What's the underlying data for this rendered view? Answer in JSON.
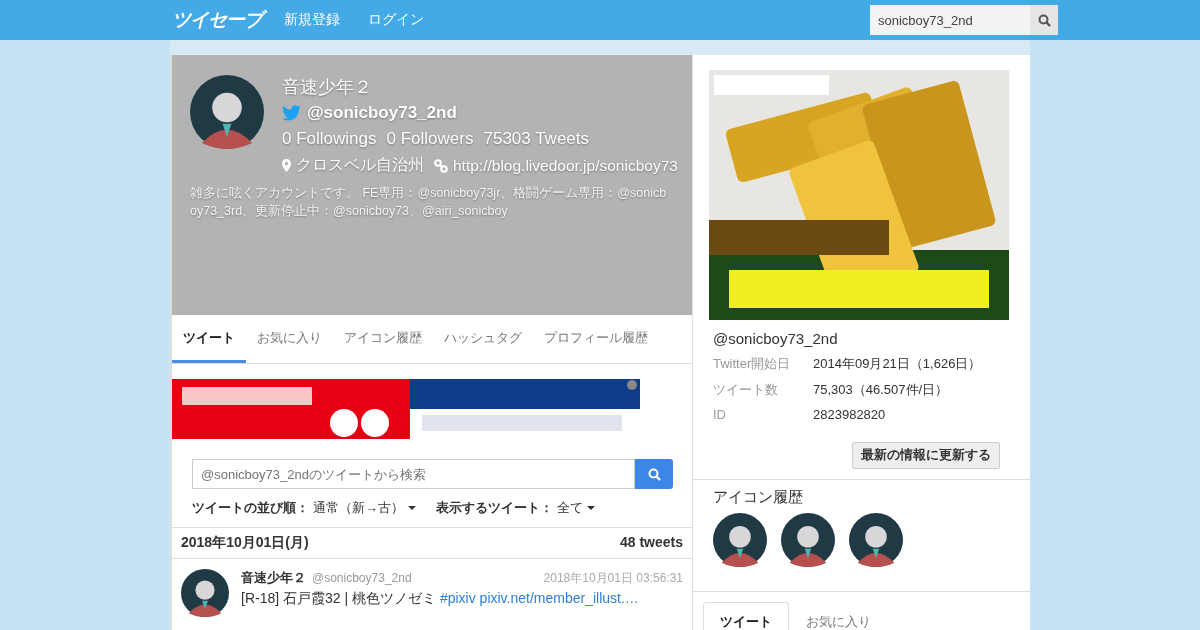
{
  "header": {
    "logo": "ツイセーブ",
    "nav": [
      "新規登録",
      "ログイン"
    ],
    "search": {
      "value": "sonicboy73_2nd"
    }
  },
  "profile": {
    "name": "音速少年２",
    "handle": "@sonicboy73_2nd",
    "stats": [
      {
        "count": "0",
        "label": "Followings"
      },
      {
        "count": "0",
        "label": "Followers"
      },
      {
        "count": "75303",
        "label": "Tweets"
      }
    ],
    "location": "クロスベル自治州",
    "url": "http://blog.livedoor.jp/sonicboy73",
    "bio": "雑多に呟くアカウントです。 FE専用：@sonicboy73jr、格闘ゲーム専用：@sonicboy73_3rd、更新停止中：@sonicboy73、@airi_sonicboy"
  },
  "tabs": [
    {
      "label": "ツイート",
      "selected": true
    },
    {
      "label": "お気に入り",
      "selected": false
    },
    {
      "label": "アイコン履歴",
      "selected": false
    },
    {
      "label": "ハッシュタグ",
      "selected": false
    },
    {
      "label": "プロフィール履歴",
      "selected": false
    }
  ],
  "tweet_search": {
    "placeholder": "@sonicboy73_2ndのツイートから検索"
  },
  "filters": [
    {
      "label": "ツイートの並び順：",
      "value": "通常（新→古）"
    },
    {
      "label": "表示するツイート：",
      "value": "全て"
    }
  ],
  "day": {
    "date": "2018年10月01日(月)",
    "count": "48 tweets"
  },
  "tweets": [
    {
      "name": "音速少年２",
      "handle": "@sonicboy73_2nd",
      "time": "2018年10月01日 03:56:31",
      "text": "[R-18] 石戸霞32 | 桃色ツノゼミ ",
      "links": [
        "#pixiv",
        "pixiv.net/member_illust.…"
      ]
    }
  ],
  "sidebar": {
    "handle": "@sonicboy73_2nd",
    "info": [
      {
        "label": "Twitter開始日",
        "value": "2014年09月21日（1,626日）"
      },
      {
        "label": "ツイート数",
        "value": "75,303（46.507件/日）"
      },
      {
        "label": "ID",
        "value": "2823982820"
      }
    ],
    "refresh_button": "最新の情報に更新する",
    "icon_history_title": "アイコン履歴",
    "icons": [
      {
        "kind": "avatar"
      },
      {
        "kind": "avatar"
      },
      {
        "kind": "avatar"
      }
    ],
    "tabs": [
      {
        "label": "ツイート",
        "selected": true
      },
      {
        "label": "お気に入り",
        "selected": false
      }
    ]
  }
}
